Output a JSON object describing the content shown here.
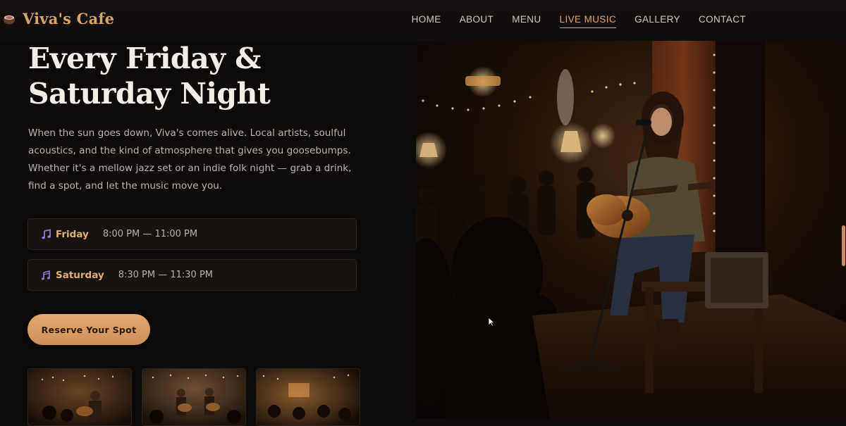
{
  "nav": {
    "brand": "Viva's Cafe",
    "brand_icon": "coffee-cup-icon",
    "links": [
      {
        "label": "HOME",
        "active": false
      },
      {
        "label": "ABOUT",
        "active": false
      },
      {
        "label": "MENU",
        "active": false
      },
      {
        "label": "LIVE MUSIC",
        "active": true
      },
      {
        "label": "GALLERY",
        "active": false
      },
      {
        "label": "CONTACT",
        "active": false
      }
    ]
  },
  "hero": {
    "headline_line1": "Every Friday &",
    "headline_line2": "Saturday Night",
    "intro": "When the sun goes down, Viva's comes alive. Local artists, soulful acoustics, and the kind of atmosphere that gives you goosebumps. Whether it's a mellow jazz set or an indie folk night — grab a drink, find a spot, and let the music move you.",
    "schedule": [
      {
        "day": "Friday",
        "time": "8:00 PM — 11:00 PM",
        "icon": "music-note-icon"
      },
      {
        "day": "Saturday",
        "time": "8:30 PM — 11:30 PM",
        "icon": "music-notes-icon"
      }
    ],
    "cta": "Reserve Your Spot"
  },
  "colors": {
    "accent": "#e0a56b",
    "background": "#0d0b0a",
    "icon_purple": "#7f6ad6"
  }
}
